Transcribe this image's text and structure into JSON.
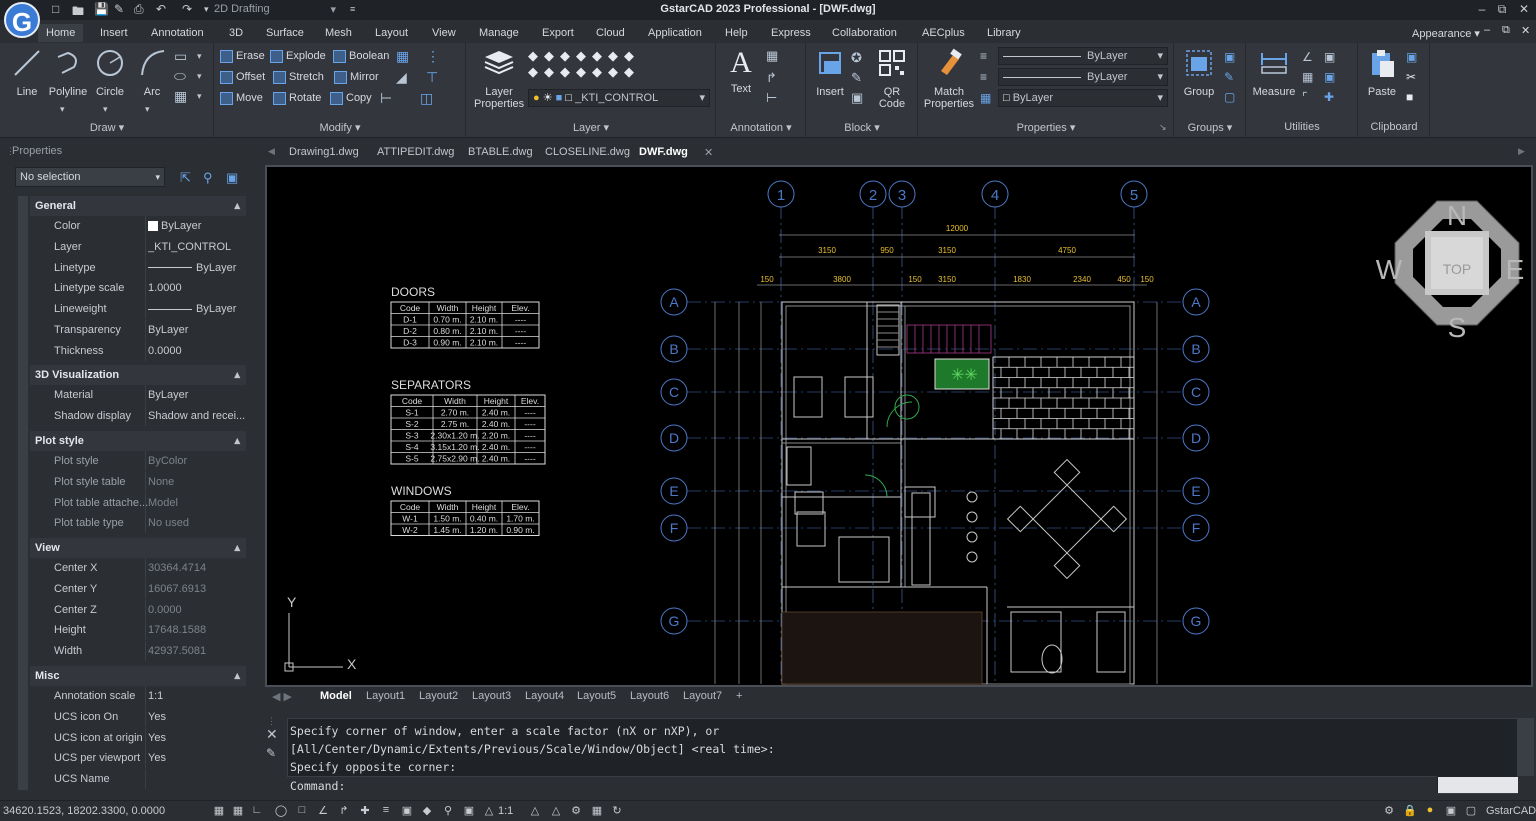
{
  "app": {
    "title": "GstarCAD 2023 Professional - [DWF.dwg]",
    "workspace": "2D Drafting",
    "logo_letter": "G"
  },
  "menu": [
    "Home",
    "Insert",
    "Annotation",
    "3D",
    "Surface",
    "Mesh",
    "Layout",
    "View",
    "Manage",
    "Export",
    "Cloud",
    "Application",
    "Help",
    "Express",
    "Collaboration",
    "AECplus",
    "Library"
  ],
  "appearance_label": "Appearance",
  "ribbon": {
    "draw": {
      "title": "Draw",
      "line": "Line",
      "polyline": "Polyline",
      "circle": "Circle",
      "arc": "Arc"
    },
    "modify": {
      "title": "Modify",
      "erase": "Erase",
      "explode": "Explode",
      "boolean": "Boolean",
      "offset": "Offset",
      "stretch": "Stretch",
      "mirror": "Mirror",
      "move": "Move",
      "rotate": "Rotate",
      "copy": "Copy"
    },
    "layer": {
      "title": "Layer",
      "layer_properties_1": "Layer",
      "layer_properties_2": "Properties",
      "current_layer": "_KTI_CONTROL"
    },
    "annotation": {
      "title": "Annotation",
      "text": "Text"
    },
    "block": {
      "title": "Block",
      "insert": "Insert",
      "qr1": "QR",
      "qr2": "Code"
    },
    "properties": {
      "title": "Properties",
      "match1": "Match",
      "match2": "Properties",
      "bylayer1": "ByLayer",
      "bylayer2": "ByLayer",
      "bylayer3": "ByLayer"
    },
    "groups": {
      "title": "Groups",
      "group": "Group"
    },
    "utilities": {
      "title": "Utilities",
      "measure": "Measure"
    },
    "clipboard": {
      "title": "Clipboard",
      "paste": "Paste"
    }
  },
  "properties_panel": {
    "title": "Properties",
    "selection": "No selection",
    "sections": {
      "general": "General",
      "visualization": "3D Visualization",
      "plot_style": "Plot style",
      "view": "View",
      "misc": "Misc"
    },
    "general": [
      {
        "label": "Color",
        "value": "ByLayer"
      },
      {
        "label": "Layer",
        "value": "_KTI_CONTROL"
      },
      {
        "label": "Linetype",
        "value": "ByLayer"
      },
      {
        "label": "Linetype scale",
        "value": "1.0000"
      },
      {
        "label": "Lineweight",
        "value": "ByLayer"
      },
      {
        "label": "Transparency",
        "value": "ByLayer"
      },
      {
        "label": "Thickness",
        "value": "0.0000"
      }
    ],
    "visualization": [
      {
        "label": "Material",
        "value": "ByLayer"
      },
      {
        "label": "Shadow display",
        "value": "Shadow and recei..."
      }
    ],
    "plot_style": [
      {
        "label": "Plot style",
        "value": "ByColor"
      },
      {
        "label": "Plot style table",
        "value": "None"
      },
      {
        "label": "Plot table attache...",
        "value": "Model"
      },
      {
        "label": "Plot table type",
        "value": "No used"
      }
    ],
    "view": [
      {
        "label": "Center X",
        "value": "30364.4714"
      },
      {
        "label": "Center Y",
        "value": "16067.6913"
      },
      {
        "label": "Center Z",
        "value": "0.0000"
      },
      {
        "label": "Height",
        "value": "17648.1588"
      },
      {
        "label": "Width",
        "value": "42937.5081"
      }
    ],
    "misc": [
      {
        "label": "Annotation scale",
        "value": "1:1"
      },
      {
        "label": "UCS icon On",
        "value": "Yes"
      },
      {
        "label": "UCS icon at origin",
        "value": "Yes"
      },
      {
        "label": "UCS per viewport",
        "value": "Yes"
      },
      {
        "label": "UCS Name",
        "value": ""
      }
    ]
  },
  "doc_tabs": [
    "Drawing1.dwg",
    "ATTIPEDIT.dwg",
    "BTABLE.dwg",
    "CLOSELINE.dwg",
    "DWF.dwg"
  ],
  "layout_tabs": [
    "Model",
    "Layout1",
    "Layout2",
    "Layout3",
    "Layout4",
    "Layout5",
    "Layout6",
    "Layout7"
  ],
  "command": {
    "line1": "Specify corner of window, enter a scale factor (nX or nXP), or",
    "line2": "[All/Center/Dynamic/Extents/Previous/Scale/Window/Object] <real time>:",
    "line3": "Specify opposite corner:",
    "prompt": "Command:"
  },
  "status": {
    "coords": "34620.1523, 18202.3300, 0.0000",
    "scale": "1:1",
    "brand": "GstarCAD"
  },
  "viewcube": {
    "n": "N",
    "s": "S",
    "e": "E",
    "w": "W",
    "top": "TOP"
  },
  "ucs": {
    "x": "X",
    "y": "Y"
  },
  "drawing": {
    "doors_title": "DOORS",
    "doors_header": [
      "Code",
      "Width",
      "Height",
      "Elev."
    ],
    "doors_rows": [
      [
        "D-1",
        "0.70 m.",
        "2.10 m.",
        "----"
      ],
      [
        "D-2",
        "0.80 m.",
        "2.10 m.",
        "----"
      ],
      [
        "D-3",
        "0.90 m.",
        "2.10 m.",
        "----"
      ]
    ],
    "sep_title": "SEPARATORS",
    "sep_header": [
      "Code",
      "Width",
      "Height",
      "Elev."
    ],
    "sep_rows": [
      [
        "S-1",
        "2.70 m.",
        "2.40 m.",
        "----"
      ],
      [
        "S-2",
        "2.75 m.",
        "2.40 m.",
        "----"
      ],
      [
        "S-3",
        "2.30x1.20 m.",
        "2.20 m.",
        "----"
      ],
      [
        "S-4",
        "3.15x1.20 m.",
        "2.40 m.",
        "----"
      ],
      [
        "S-5",
        "2.75x2.90 m.",
        "2.40 m.",
        "----"
      ]
    ],
    "win_title": "WINDOWS",
    "win_header": [
      "Code",
      "Width",
      "Height",
      "Elev."
    ],
    "win_rows": [
      [
        "W-1",
        "1.50 m.",
        "0.40 m.",
        "1.70 m."
      ],
      [
        "W-2",
        "1.45 m.",
        "1.20 m.",
        "0.90 m."
      ]
    ],
    "grid_numbers": [
      "1",
      "2",
      "3",
      "4",
      "5"
    ],
    "grid_letters": [
      "A",
      "B",
      "C",
      "D",
      "E",
      "F",
      "G"
    ],
    "dim_total": "12000",
    "dims_top": [
      "3150",
      "950",
      "3150",
      "4750"
    ],
    "dims_row2": [
      "150",
      "3800",
      "150",
      "3150",
      "1830",
      "2340",
      "450",
      "150"
    ]
  }
}
